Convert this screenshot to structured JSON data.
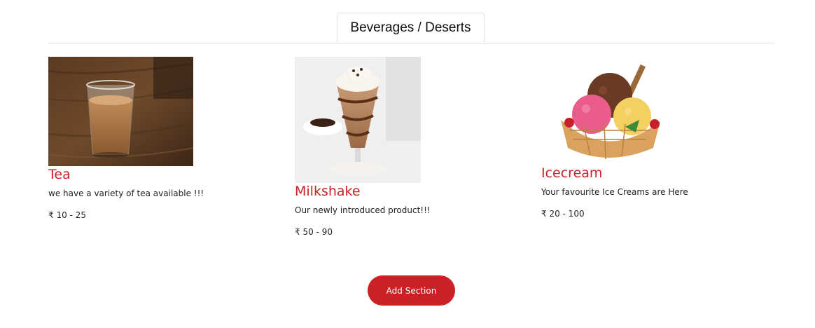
{
  "tabs": [
    {
      "label": "Beverages / Deserts",
      "active": true
    }
  ],
  "items": [
    {
      "title": "Tea",
      "description": "we have a variety of tea available !!!",
      "price": "₹ 10 - 25",
      "image": "tea-glass-image"
    },
    {
      "title": "Milkshake",
      "description": "Our newly introduced product!!!",
      "price": "₹ 50 - 90",
      "image": "milkshake-glass-image"
    },
    {
      "title": "Icecream",
      "description": "Your favourite Ice Creams are Here",
      "price": "₹ 20 - 100",
      "image": "icecream-bowl-image"
    }
  ],
  "actions": {
    "add_section_label": "Add Section"
  },
  "colors": {
    "accent": "#cc2027",
    "tab_border": "#dee2e6"
  }
}
